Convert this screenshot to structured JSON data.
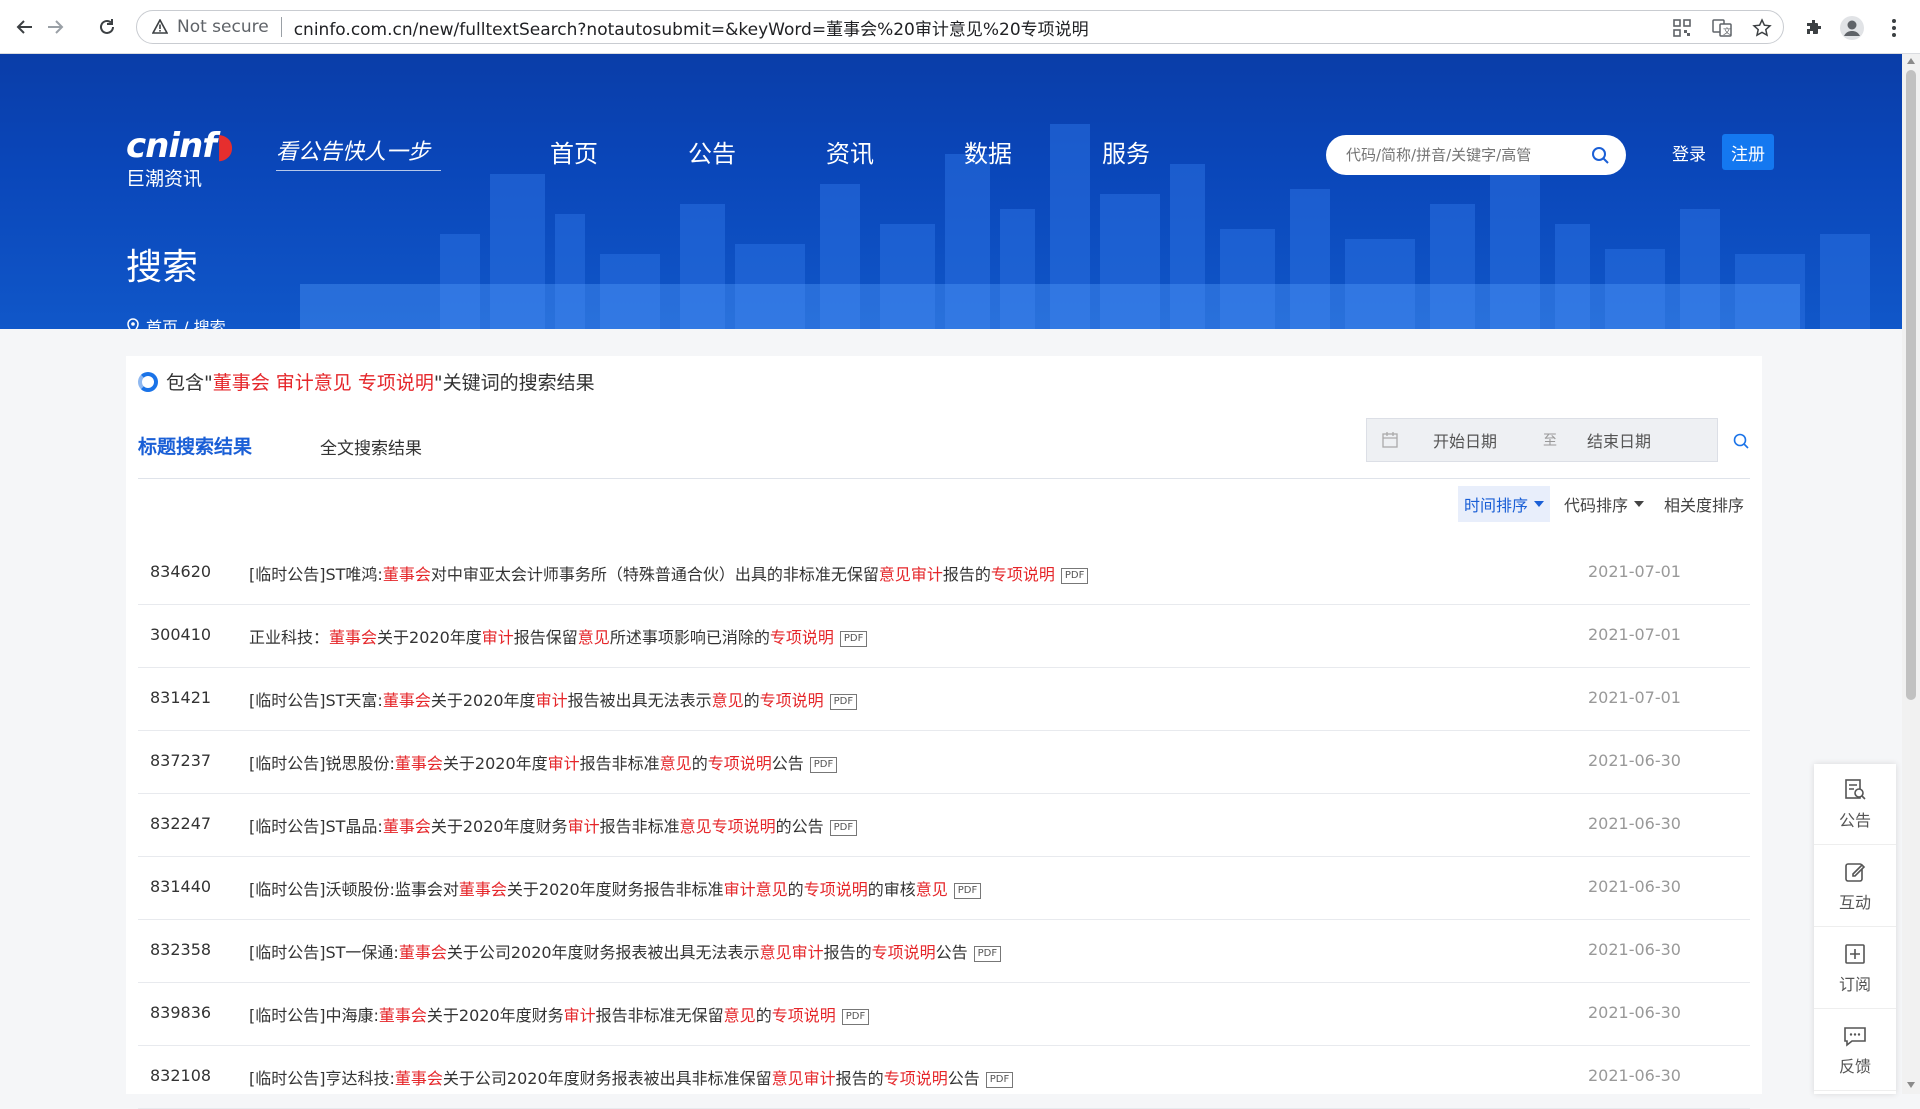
{
  "browser": {
    "not_secure": "Not secure",
    "url": "cninfo.com.cn/new/fulltextSearch?notautosubmit=&keyWord=董事会%20审计意见%20专项说明"
  },
  "header": {
    "logo_text_a": "cninf",
    "logo_sub": "巨潮资讯",
    "slogan": "看公告快人一步",
    "nav": [
      "首页",
      "公告",
      "资讯",
      "数据",
      "服务"
    ],
    "search_placeholder": "代码/简称/拼音/关键字/高管",
    "login": "登录",
    "register": "注册",
    "page_title": "搜索",
    "breadcrumb": "首页 / 搜索"
  },
  "results": {
    "kw_prefix": "包含\"",
    "kw_terms": "董事会 审计意见 专项说明",
    "kw_suffix": "\"关键词的搜索结果",
    "tab_title": "标题搜索结果",
    "tab_fulltext": "全文搜索结果",
    "date_start": "开始日期",
    "date_to": "至",
    "date_end": "结束日期",
    "sort_time": "时间排序",
    "sort_code": "代码排序",
    "sort_relevance": "相关度排序",
    "pdf_label": "PDF",
    "rows": [
      {
        "code": "834620",
        "date": "2021-07-01",
        "parts": [
          [
            "[临时公告]ST唯鸿:",
            0
          ],
          [
            "董事会",
            1
          ],
          [
            "对中审亚太会计师事务所（特殊普通合伙）出具的非标准无保留",
            0
          ],
          [
            "意见",
            1
          ],
          [
            "审计",
            1
          ],
          [
            "报告的",
            0
          ],
          [
            "专项说明",
            1
          ]
        ]
      },
      {
        "code": "300410",
        "date": "2021-07-01",
        "parts": [
          [
            "正业科技：",
            0
          ],
          [
            "董事会",
            1
          ],
          [
            "关于2020年度",
            0
          ],
          [
            "审计",
            1
          ],
          [
            "报告保留",
            0
          ],
          [
            "意见",
            1
          ],
          [
            "所述事项影响已消除的",
            0
          ],
          [
            "专项说明",
            1
          ]
        ]
      },
      {
        "code": "831421",
        "date": "2021-07-01",
        "parts": [
          [
            "[临时公告]ST天富:",
            0
          ],
          [
            "董事会",
            1
          ],
          [
            "关于2020年度",
            0
          ],
          [
            "审计",
            1
          ],
          [
            "报告被出具无法表示",
            0
          ],
          [
            "意见",
            1
          ],
          [
            "的",
            0
          ],
          [
            "专项说明",
            1
          ]
        ]
      },
      {
        "code": "837237",
        "date": "2021-06-30",
        "parts": [
          [
            "[临时公告]锐思股份:",
            0
          ],
          [
            "董事会",
            1
          ],
          [
            "关于2020年度",
            0
          ],
          [
            "审计",
            1
          ],
          [
            "报告非标准",
            0
          ],
          [
            "意见",
            1
          ],
          [
            "的",
            0
          ],
          [
            "专项说明",
            1
          ],
          [
            "公告",
            0
          ]
        ]
      },
      {
        "code": "832247",
        "date": "2021-06-30",
        "parts": [
          [
            "[临时公告]ST晶品:",
            0
          ],
          [
            "董事会",
            1
          ],
          [
            "关于2020年度财务",
            0
          ],
          [
            "审计",
            1
          ],
          [
            "报告非标准",
            0
          ],
          [
            "意见",
            1
          ],
          [
            "专项说明",
            1
          ],
          [
            "的公告",
            0
          ]
        ]
      },
      {
        "code": "831440",
        "date": "2021-06-30",
        "parts": [
          [
            "[临时公告]沃顿股份:监事会对",
            0
          ],
          [
            "董事会",
            1
          ],
          [
            "关于2020年度财务报告非标准",
            0
          ],
          [
            "审计",
            1
          ],
          [
            "意见",
            1
          ],
          [
            "的",
            0
          ],
          [
            "专项说明",
            1
          ],
          [
            "的审核",
            0
          ],
          [
            "意见",
            1
          ]
        ]
      },
      {
        "code": "832358",
        "date": "2021-06-30",
        "parts": [
          [
            "[临时公告]ST一保通:",
            0
          ],
          [
            "董事会",
            1
          ],
          [
            "关于公司2020年度财务报表被出具无法表示",
            0
          ],
          [
            "意见",
            1
          ],
          [
            "审计",
            1
          ],
          [
            "报告的",
            0
          ],
          [
            "专项说明",
            1
          ],
          [
            "公告",
            0
          ]
        ]
      },
      {
        "code": "839836",
        "date": "2021-06-30",
        "parts": [
          [
            "[临时公告]中海康:",
            0
          ],
          [
            "董事会",
            1
          ],
          [
            "关于2020年度财务",
            0
          ],
          [
            "审计",
            1
          ],
          [
            "报告非标准无保留",
            0
          ],
          [
            "意见",
            1
          ],
          [
            "的",
            0
          ],
          [
            "专项说明",
            1
          ]
        ]
      },
      {
        "code": "832108",
        "date": "2021-06-30",
        "parts": [
          [
            "[临时公告]亨达科技:",
            0
          ],
          [
            "董事会",
            1
          ],
          [
            "关于公司2020年度财务报表被出具非标准保留",
            0
          ],
          [
            "意见",
            1
          ],
          [
            "审计",
            1
          ],
          [
            "报告的",
            0
          ],
          [
            "专项说明",
            1
          ],
          [
            "公告",
            0
          ]
        ]
      }
    ]
  },
  "side": [
    "公告",
    "互动",
    "订阅",
    "反馈"
  ],
  "colors": {
    "brand_blue": "#0a46b9",
    "highlight_red": "#e5262a",
    "active_tab": "#1a5fd6"
  }
}
